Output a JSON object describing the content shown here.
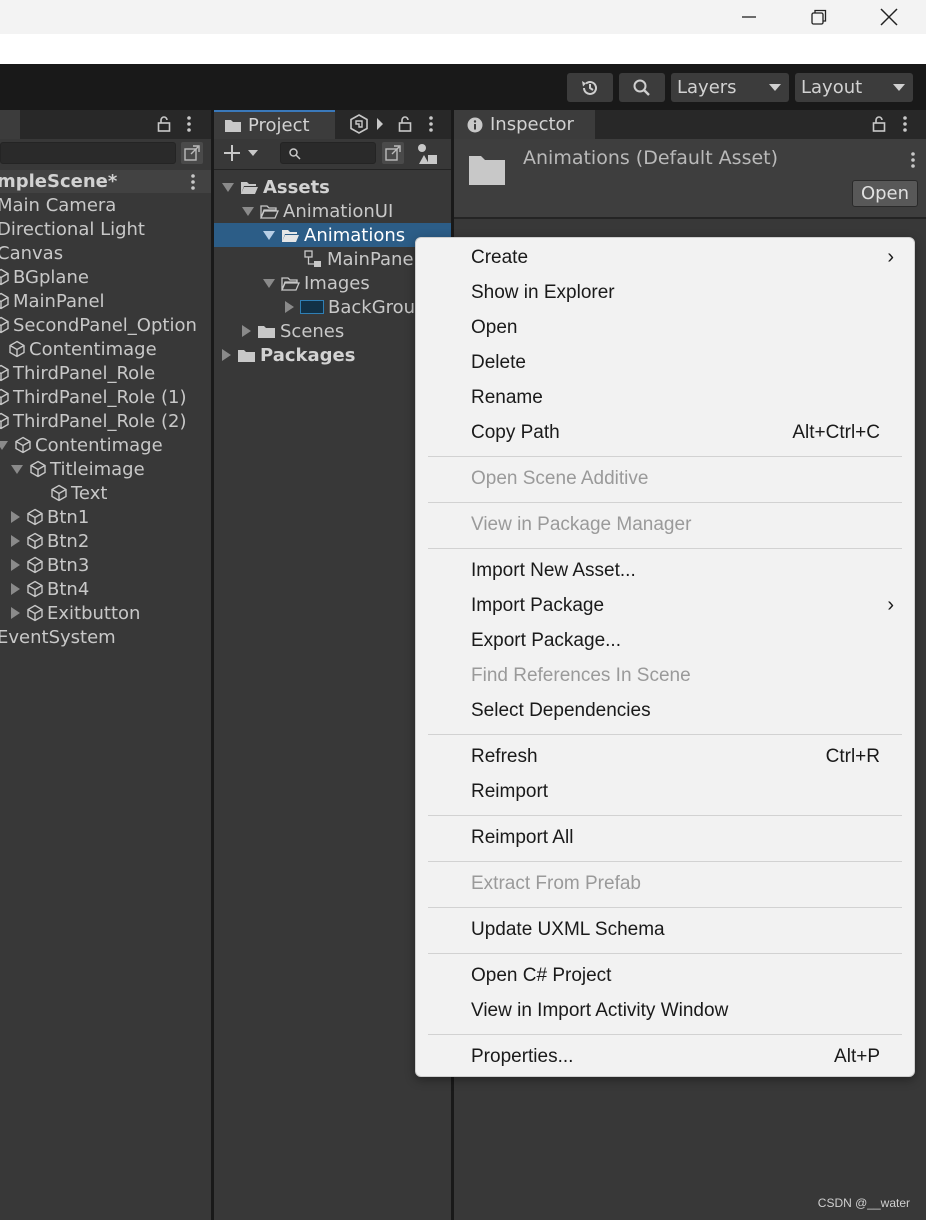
{
  "window": {
    "controls": [
      "minimize-icon",
      "restore-icon",
      "close-icon"
    ]
  },
  "toolbar": {
    "history_icon": "history-icon",
    "search_icon": "search-icon",
    "layers_label": "Layers",
    "layout_label": "Layout"
  },
  "hierarchy": {
    "scene_name": "mpleScene*",
    "items": [
      {
        "label": "Main Camera"
      },
      {
        "label": "Directional Light"
      },
      {
        "label": "Canvas"
      },
      {
        "label": "BGplane"
      },
      {
        "label": "MainPanel"
      },
      {
        "label": "SecondPanel_Option"
      },
      {
        "label": "Contentimage"
      },
      {
        "label": "ThirdPanel_Role"
      },
      {
        "label": "ThirdPanel_Role (1)"
      },
      {
        "label": "ThirdPanel_Role (2)"
      },
      {
        "label": "Contentimage"
      },
      {
        "label": "Titleimage"
      },
      {
        "label": "Text"
      },
      {
        "label": "Btn1"
      },
      {
        "label": "Btn2"
      },
      {
        "label": "Btn3"
      },
      {
        "label": "Btn4"
      },
      {
        "label": "Exitbutton"
      },
      {
        "label": "EventSystem"
      }
    ]
  },
  "project": {
    "tab_label": "Project",
    "tree": [
      {
        "label": "Assets"
      },
      {
        "label": "AnimationUI"
      },
      {
        "label": "Animations"
      },
      {
        "label": "MainPane"
      },
      {
        "label": "Images"
      },
      {
        "label": "BackGrou"
      },
      {
        "label": "Scenes"
      },
      {
        "label": "Packages"
      }
    ]
  },
  "inspector": {
    "tab_label": "Inspector",
    "asset_title": "Animations (Default Asset)",
    "open_button": "Open"
  },
  "context_menu": {
    "items": [
      {
        "label": "Create",
        "submenu": true
      },
      {
        "label": "Show in Explorer"
      },
      {
        "label": "Open"
      },
      {
        "label": "Delete"
      },
      {
        "label": "Rename"
      },
      {
        "label": "Copy Path",
        "shortcut": "Alt+Ctrl+C"
      },
      {
        "label": "Open Scene Additive",
        "disabled": true
      },
      {
        "label": "View in Package Manager",
        "disabled": true
      },
      {
        "label": "Import New Asset..."
      },
      {
        "label": "Import Package",
        "submenu": true
      },
      {
        "label": "Export Package..."
      },
      {
        "label": "Find References In Scene",
        "disabled": true
      },
      {
        "label": "Select Dependencies"
      },
      {
        "label": "Refresh",
        "shortcut": "Ctrl+R"
      },
      {
        "label": "Reimport"
      },
      {
        "label": "Reimport All"
      },
      {
        "label": "Extract From Prefab",
        "disabled": true
      },
      {
        "label": "Update UXML Schema"
      },
      {
        "label": "Open C# Project"
      },
      {
        "label": "View in Import Activity Window"
      },
      {
        "label": "Properties...",
        "shortcut": "Alt+P"
      }
    ]
  },
  "colors": {
    "selection": "#2c5d87",
    "active_tab_accent": "#3a79bb",
    "panel_bg": "#383838",
    "menu_bg": "#f2f2f2"
  },
  "watermark": "CSDN @__water"
}
